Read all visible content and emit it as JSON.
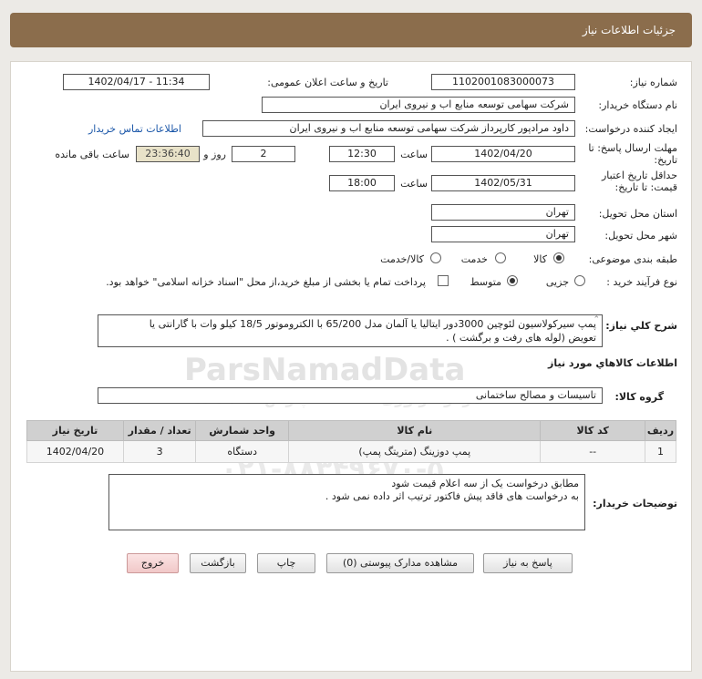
{
  "header": {
    "title": "جزئیات اطلاعات نیاز"
  },
  "form": {
    "need_number_label": "شماره نیاز:",
    "need_number": "1102001083000073",
    "announce_label": "تاریخ و ساعت اعلان عمومی:",
    "announce_value": "1402/04/17 - 11:34",
    "buyer_label": "نام دستگاه خریدار:",
    "buyer_value": "شرکت سهامی توسعه منابع اب و نیروی ایران",
    "creator_label": "ایجاد کننده درخواست:",
    "creator_value": "داود مرادپور کارپرداز شرکت سهامی توسعه منابع اب و نیروی ایران",
    "contact_link": "اطلاعات تماس خریدار",
    "deadline_label_1": "مهلت ارسال پاسخ: تا",
    "deadline_label_2": "تاریخ:",
    "deadline_date": "1402/04/20",
    "time_label": "ساعت",
    "deadline_time": "12:30",
    "days_value": "2",
    "days_label": "روز و",
    "remaining_time": "23:36:40",
    "remaining_label": "ساعت باقی مانده",
    "validity_label_1": "حداقل تاریخ اعتبار",
    "validity_label_2": "قیمت: تا تاریخ:",
    "validity_date": "1402/05/31",
    "validity_time_label": "ساعت",
    "validity_time": "18:00",
    "province_label": "استان محل تحویل:",
    "province_value": "تهران",
    "city_label": "شهر محل تحویل:",
    "city_value": "تهران",
    "category_label": "طبقه بندی موضوعی:",
    "category_options": [
      "کالا",
      "خدمت",
      "کالا/خدمت"
    ],
    "process_label": "نوع فرآیند خرید :",
    "process_options": [
      "جزیی",
      "متوسط"
    ],
    "payment_note": "پرداخت تمام یا بخشی از مبلغ خرید،از محل \"اسناد خزانه اسلامی\" خواهد بود.",
    "description_label": "شرح کلي نياز:",
    "description_line1": "پمپ سیرکولاسیون لئوچین 3000دور ایتالیا یا آلمان مدل 65/200 با الکتروموتور 18/5 کیلو وات با گارانتی یا",
    "description_line2": "تعویض (لوله های رفت و برگشت ) ."
  },
  "goods": {
    "section_title": "اطلاعات کالاهاي مورد نياز",
    "group_label": "گروه کالا:",
    "group_value": "تاسیسات و مصالح ساختمانی",
    "columns": [
      "ردیف",
      "کد کالا",
      "نام کالا",
      "واحد شمارش",
      "تعداد / مقدار",
      "تاریخ نیاز"
    ],
    "rows": [
      [
        "1",
        "--",
        "پمپ دوزینگ (متریتگ پمپ)",
        "دستگاه",
        "3",
        "1402/04/20"
      ]
    ]
  },
  "buyer_notes": {
    "label": "توضیحات خریدار:",
    "line1": "مطابق درخواست یک از سه اعلام قیمت شود",
    "line2": "به درخواست های فاقد پیش فاکتور ترتیب اثر داده نمی شود ."
  },
  "buttons": {
    "reply": "پاسخ به نیاز",
    "attachments": "مشاهده مدارک پیوستی (0)",
    "print": "چاپ",
    "back": "بازگشت",
    "exit": "خروج"
  },
  "watermark": {
    "brand": "ParsNamadData",
    "line_fa_1": "مرکز فراوری اطلاعات پارس نماد داده",
    "line_fa_2": "پایگاه اطلاع رسانی مناقصه و مزایده",
    "phone": "۰۲۱-۸۸۳۴۹۶۷۰-۵"
  }
}
